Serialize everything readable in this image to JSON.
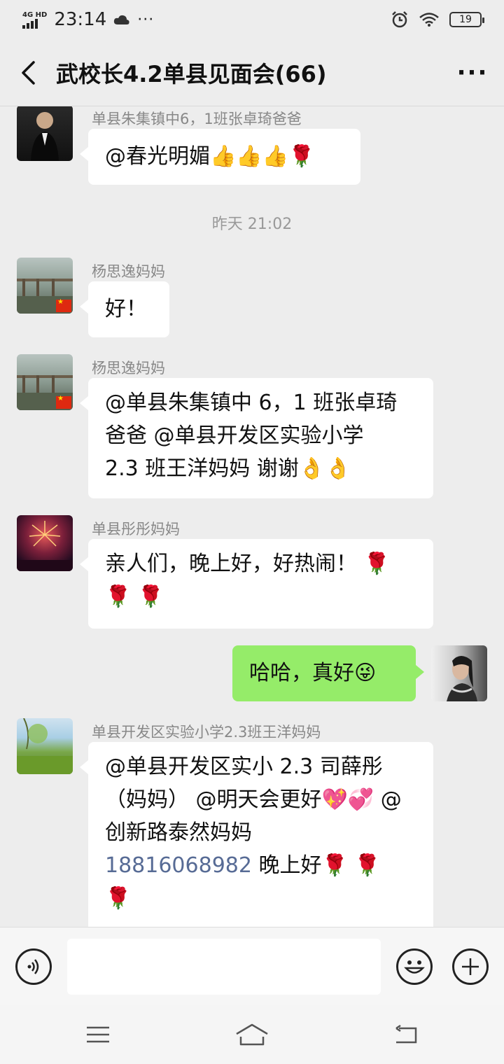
{
  "status_bar": {
    "network": "4G HD",
    "time": "23:14",
    "icons": [
      "signal-icon",
      "cloud-icon",
      "more-dots-icon",
      "alarm-icon",
      "wifi-icon",
      "battery-icon"
    ],
    "battery": "19"
  },
  "header": {
    "title": "武校长4.2单县见面会(66)",
    "back_icon": "chevron-left-icon",
    "more_icon": "more-icon",
    "more_label": "···"
  },
  "chat": {
    "timestamp": "昨天 21:02",
    "messages": [
      {
        "sender": "单县朱集镇中6，1班张卓琦爸爸",
        "avatar": "man-in-suit",
        "text": "@春光明媚👍👍👍🌹"
      },
      {
        "sender": "杨思逸妈妈",
        "avatar": "riverside-railing",
        "text": "好！"
      },
      {
        "sender": "杨思逸妈妈",
        "avatar": "riverside-railing",
        "lines": [
          "@单县朱集镇中 6，1 班张卓琦",
          "爸爸 @单县开发区实验小学",
          "2.3 班王洋妈妈  谢谢👌👌"
        ]
      },
      {
        "sender": "单县彤彤妈妈",
        "avatar": "fireworks",
        "lines": [
          "亲人们，晚上好，好热闹！ 🌹",
          "🌹 🌹"
        ]
      },
      {
        "self": true,
        "avatar": "woman-profile",
        "text": "哈哈，真好😜"
      },
      {
        "sender": "单县开发区实验小学2.3班王洋妈妈",
        "avatar": "green-meadow",
        "lines": [
          "@单县开发区实小 2.3 司薛彤",
          "（妈妈） @明天会更好💖💞 @",
          "创新路泰然妈妈"
        ],
        "phone": "18816068982",
        "tail": " 晚上好🌹 🌹",
        "last_line": "🌹"
      }
    ]
  },
  "input_bar": {
    "voice_icon": "voice-icon",
    "input_value": "",
    "emoji_icon": "emoji-icon",
    "plus_icon": "plus-icon"
  },
  "nav_bar": {
    "icons": [
      "menu-icon",
      "home-icon",
      "back-icon"
    ]
  },
  "colors": {
    "background": "#ededed",
    "bubble_self": "#95ec69",
    "bubble_other": "#ffffff",
    "link": "#576b95"
  }
}
